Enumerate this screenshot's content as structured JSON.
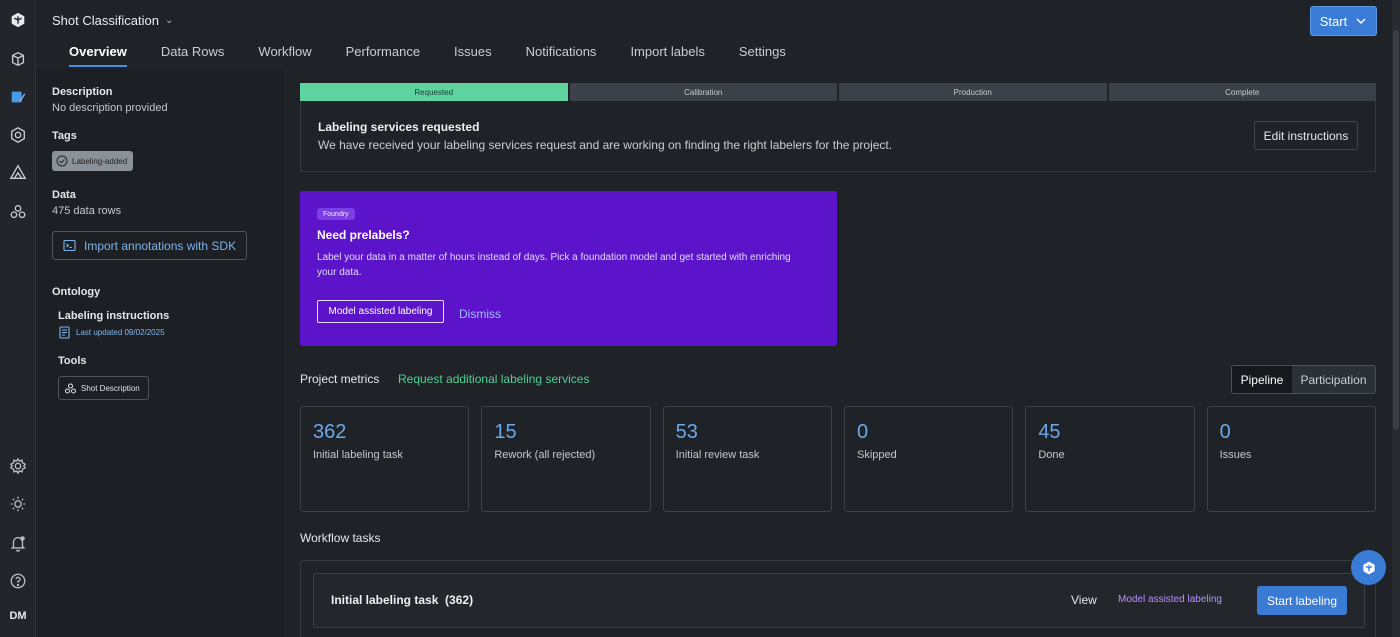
{
  "header": {
    "project_title": "Shot Classification",
    "start_label": "Start",
    "tabs": [
      {
        "label": "Overview",
        "active": true
      },
      {
        "label": "Data Rows"
      },
      {
        "label": "Workflow"
      },
      {
        "label": "Performance"
      },
      {
        "label": "Issues"
      },
      {
        "label": "Notifications"
      },
      {
        "label": "Import labels"
      },
      {
        "label": "Settings"
      }
    ]
  },
  "sidebar_rail": {
    "icons": [
      "labelbox-logo-icon",
      "catalog-icon",
      "annotate-icon",
      "model-icon",
      "alert-icon",
      "workforce-icon",
      "settings-icon",
      "theme-icon",
      "notifications-icon",
      "help-icon"
    ],
    "avatar_initials": "DM"
  },
  "info": {
    "description_label": "Description",
    "description_value": "No description provided",
    "tags_label": "Tags",
    "tag": "Labeling-added",
    "data_label": "Data",
    "data_value": "475 data rows",
    "sdk_button": "Import annotations with SDK",
    "ontology_label": "Ontology",
    "instructions_label": "Labeling instructions",
    "instructions_updated": "Last updated 09/02/2025",
    "tools_label": "Tools",
    "tool_name": "Shot Description"
  },
  "steps": [
    {
      "label": "Requested",
      "active": true
    },
    {
      "label": "Calibration"
    },
    {
      "label": "Production"
    },
    {
      "label": "Complete"
    }
  ],
  "services": {
    "title": "Labeling services requested",
    "subtitle": "We have received your labeling services request and are working on finding the right labelers for the project.",
    "edit_button": "Edit instructions"
  },
  "foundry": {
    "badge": "Foundry",
    "title": "Need prelabels?",
    "description": "Label your data in a matter of hours instead of days. Pick a foundation model and get started with enriching your data.",
    "primary_button": "Model assisted labeling",
    "dismiss": "Dismiss"
  },
  "metrics": {
    "title": "Project metrics",
    "link": "Request additional labeling services",
    "toggle": [
      "Pipeline",
      "Participation"
    ],
    "cards": [
      {
        "value": "362",
        "label": "Initial labeling task"
      },
      {
        "value": "15",
        "label": "Rework (all rejected)"
      },
      {
        "value": "53",
        "label": "Initial review task"
      },
      {
        "value": "0",
        "label": "Skipped"
      },
      {
        "value": "45",
        "label": "Done"
      },
      {
        "value": "0",
        "label": "Issues"
      }
    ]
  },
  "workflow": {
    "title": "Workflow tasks",
    "task_name": "Initial labeling task",
    "task_count": "(362)",
    "view": "View",
    "mal": "Model assisted labeling",
    "start": "Start labeling"
  },
  "colors": {
    "accent": "#3a7bd5",
    "step_active": "#5fd4a1",
    "foundry_bg": "#5b14c9",
    "link_green": "#4fd08f",
    "metric_value": "#6ca8e8"
  }
}
